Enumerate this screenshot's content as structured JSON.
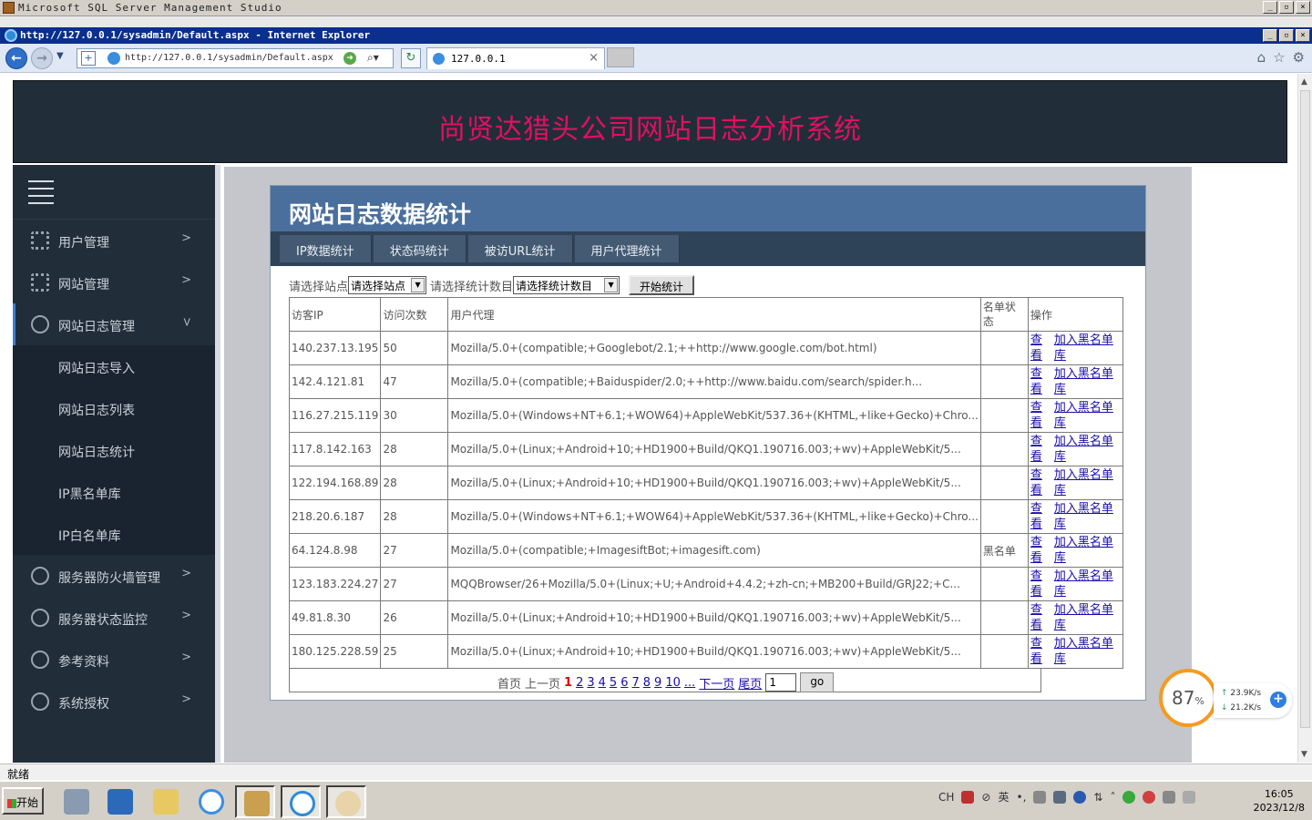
{
  "ssms": {
    "title": "Microsoft SQL Server Management Studio"
  },
  "ie": {
    "title": "http://127.0.0.1/sysadmin/Default.aspx - Internet Explorer",
    "url": "http://127.0.0.1/sysadmin/Default.aspx",
    "tab_label": "127.0.0.1",
    "status": "就绪"
  },
  "site": {
    "banner_title": "尚贤达猎头公司网站日志分析系统"
  },
  "sidebar": {
    "items": [
      {
        "label": "用户管理",
        "icon": "gear-icon"
      },
      {
        "label": "网站管理",
        "icon": "gear-icon"
      },
      {
        "label": "网站日志管理",
        "icon": "globe-icon"
      }
    ],
    "sub_items": [
      {
        "label": "网站日志导入"
      },
      {
        "label": "网站日志列表"
      },
      {
        "label": "网站日志统计"
      },
      {
        "label": "IP黑名单库"
      },
      {
        "label": "IP白名单库"
      }
    ],
    "more_items": [
      {
        "label": "服务器防火墙管理"
      },
      {
        "label": "服务器状态监控"
      },
      {
        "label": "参考资料"
      },
      {
        "label": "系统授权"
      }
    ]
  },
  "panel": {
    "title": "网站日志数据统计",
    "tabs": [
      "IP数据统计",
      "状态码统计",
      "被访URL统计",
      "用户代理统计"
    ],
    "filter": {
      "site_label": "请选择站点",
      "site_value": "请选择站点",
      "count_label": "请选择统计数目",
      "count_value": "请选择统计数目",
      "start_button": "开始统计"
    },
    "table": {
      "headers": [
        "访客IP",
        "访问次数",
        "用户代理",
        "名单状态",
        "操作"
      ],
      "view_link": "查看",
      "blacklist_link": "加入黑名单库",
      "rows": [
        {
          "ip": "140.237.13.195",
          "count": "50",
          "ua": "Mozilla/5.0+(compatible;+Googlebot/2.1;++http://www.google.com/bot.html)",
          "status": ""
        },
        {
          "ip": "142.4.121.81",
          "count": "47",
          "ua": "Mozilla/5.0+(compatible;+Baiduspider/2.0;++http://www.baidu.com/search/spider.h...",
          "status": ""
        },
        {
          "ip": "116.27.215.119",
          "count": "30",
          "ua": "Mozilla/5.0+(Windows+NT+6.1;+WOW64)+AppleWebKit/537.36+(KHTML,+like+Gecko)+Chro...",
          "status": ""
        },
        {
          "ip": "117.8.142.163",
          "count": "28",
          "ua": "Mozilla/5.0+(Linux;+Android+10;+HD1900+Build/QKQ1.190716.003;+wv)+AppleWebKit/5...",
          "status": ""
        },
        {
          "ip": "122.194.168.89",
          "count": "28",
          "ua": "Mozilla/5.0+(Linux;+Android+10;+HD1900+Build/QKQ1.190716.003;+wv)+AppleWebKit/5...",
          "status": ""
        },
        {
          "ip": "218.20.6.187",
          "count": "28",
          "ua": "Mozilla/5.0+(Windows+NT+6.1;+WOW64)+AppleWebKit/537.36+(KHTML,+like+Gecko)+Chro...",
          "status": ""
        },
        {
          "ip": "64.124.8.98",
          "count": "27",
          "ua": "Mozilla/5.0+(compatible;+ImagesiftBot;+imagesift.com)",
          "status": "黑名单"
        },
        {
          "ip": "123.183.224.27",
          "count": "27",
          "ua": "MQQBrowser/26+Mozilla/5.0+(Linux;+U;+Android+4.4.2;+zh-cn;+MB200+Build/GRJ22;+C...",
          "status": ""
        },
        {
          "ip": "49.81.8.30",
          "count": "26",
          "ua": "Mozilla/5.0+(Linux;+Android+10;+HD1900+Build/QKQ1.190716.003;+wv)+AppleWebKit/5...",
          "status": ""
        },
        {
          "ip": "180.125.228.59",
          "count": "25",
          "ua": "Mozilla/5.0+(Linux;+Android+10;+HD1900+Build/QKQ1.190716.003;+wv)+AppleWebKit/5...",
          "status": ""
        }
      ]
    },
    "pager": {
      "first": "首页",
      "prev": "上一页",
      "current": "1",
      "pages": [
        "2",
        "3",
        "4",
        "5",
        "6",
        "7",
        "8",
        "9",
        "10",
        "..."
      ],
      "next": "下一页",
      "last": "尾页",
      "input_value": "1",
      "go": "go"
    }
  },
  "net_widget": {
    "percent": "87",
    "percent_sign": "%",
    "up": "23.9K/s",
    "down": "21.2K/s"
  },
  "taskbar": {
    "start": "开始",
    "lang": "CH",
    "ime": "英",
    "time": "16:05",
    "date": "2023/12/8"
  }
}
